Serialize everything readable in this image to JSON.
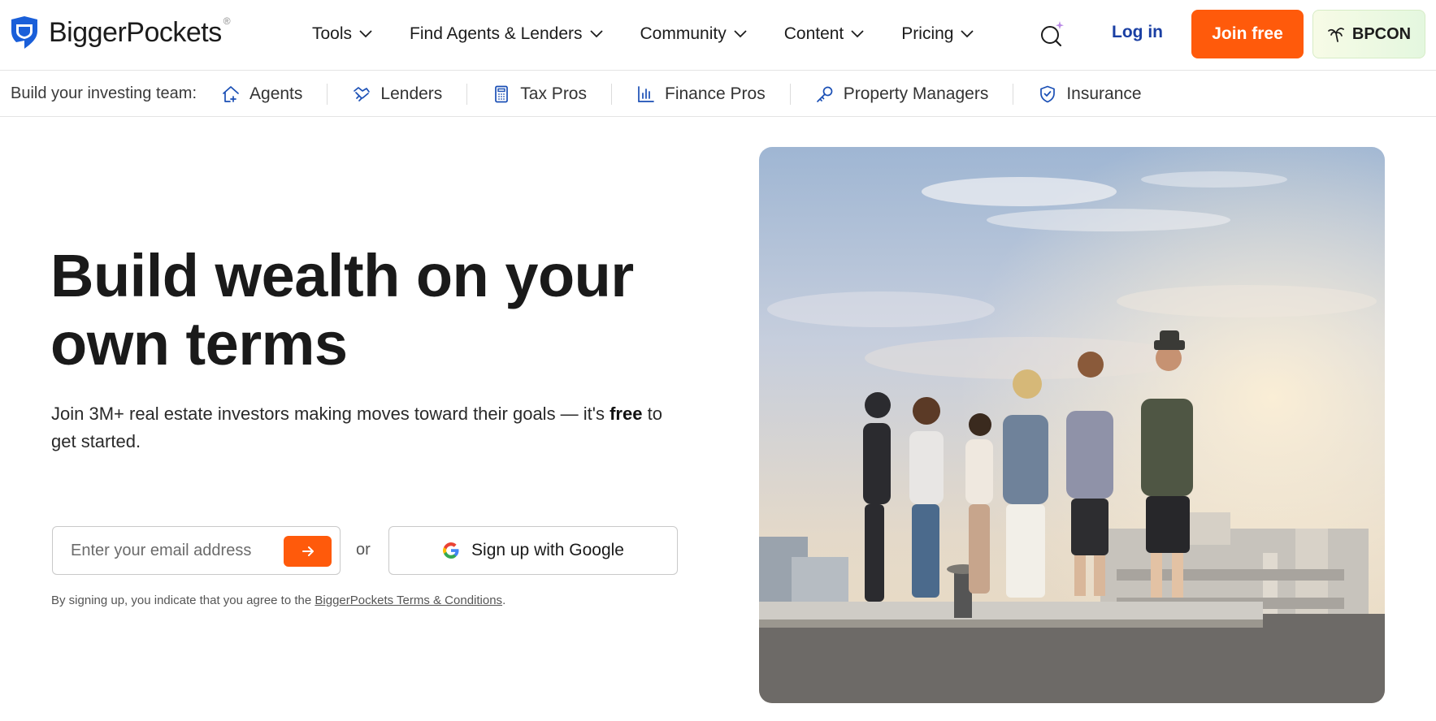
{
  "header": {
    "brand": "BiggerPockets",
    "brand_mark": "®",
    "nav": [
      {
        "label": "Tools"
      },
      {
        "label": "Find Agents & Lenders"
      },
      {
        "label": "Community"
      },
      {
        "label": "Content"
      },
      {
        "label": "Pricing"
      }
    ],
    "search_icon": "ai-search-icon",
    "login_label": "Log in",
    "join_label": "Join free",
    "bpcon_label": "BPCON",
    "colors": {
      "accent": "#ff5a0b",
      "link": "#1a3fa3"
    }
  },
  "team_bar": {
    "label": "Build your investing team:",
    "items": [
      {
        "label": "Agents",
        "icon": "house-plus-icon"
      },
      {
        "label": "Lenders",
        "icon": "handshake-icon"
      },
      {
        "label": "Tax Pros",
        "icon": "calculator-icon"
      },
      {
        "label": "Finance Pros",
        "icon": "bar-chart-icon"
      },
      {
        "label": "Property Managers",
        "icon": "key-icon"
      },
      {
        "label": "Insurance",
        "icon": "shield-check-icon"
      }
    ]
  },
  "hero": {
    "title": "Build wealth on your own terms",
    "subtitle_pre": "Join 3M+ real estate investors making moves toward their goals — it's ",
    "subtitle_bold": "free",
    "subtitle_post": " to get started.",
    "email_placeholder": "Enter your email address",
    "or_label": "or",
    "google_label": "Sign up with Google",
    "terms_pre": "By signing up, you indicate that you agree to the ",
    "terms_link": "BiggerPockets Terms & Conditions",
    "terms_post": "."
  }
}
